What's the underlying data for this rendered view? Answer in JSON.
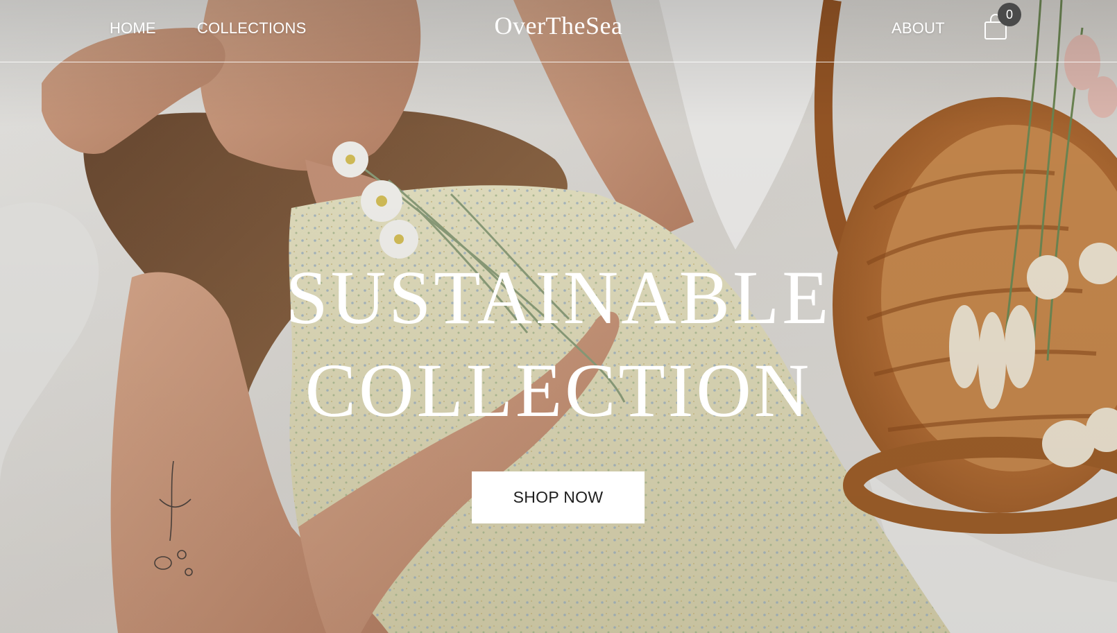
{
  "header": {
    "nav_left": [
      "HOME",
      "COLLECTIONS"
    ],
    "brand": "OverTheSea",
    "nav_right": [
      "ABOUT"
    ],
    "cart_count": "0",
    "cart_icon": "shopping-bag-icon"
  },
  "hero": {
    "headline_line1": "SUSTAINABLE",
    "headline_line2": "COLLECTION",
    "cta_label": "SHOP NOW"
  },
  "colors": {
    "text_on_image": "#ffffff",
    "cta_background": "#ffffff",
    "cta_text": "#1e1e1e",
    "badge_background": "#4a4a4a"
  }
}
